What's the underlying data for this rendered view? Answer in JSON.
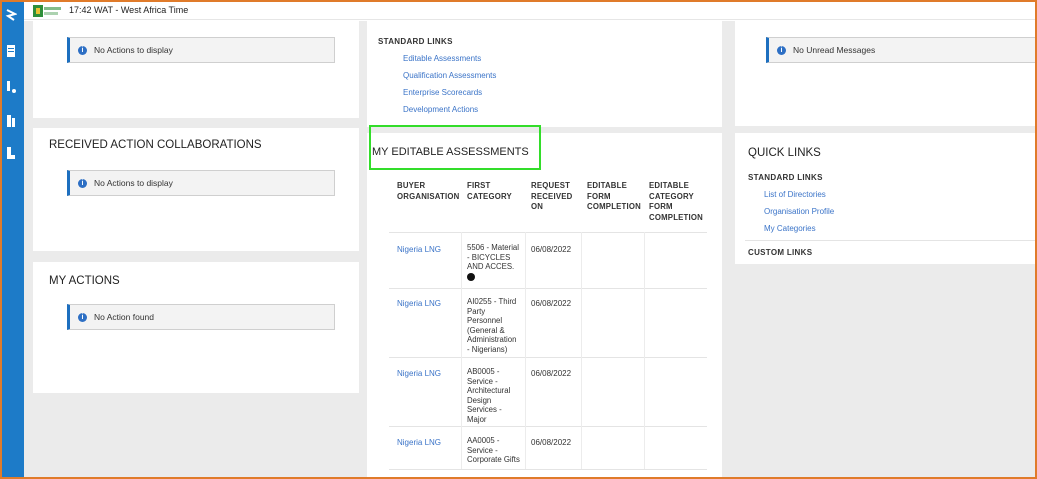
{
  "topbar": {
    "time_text": "17:42 WAT - West Africa Time"
  },
  "actions_card": {
    "message": "No Actions to display"
  },
  "received_collab": {
    "title": "RECEIVED ACTION COLLABORATIONS",
    "message": "No Actions to display"
  },
  "my_actions": {
    "title": "MY ACTIONS",
    "message": "No Action found"
  },
  "standard_links_top": {
    "heading": "STANDARD LINKS",
    "links": [
      "Editable Assessments",
      "Qualification Assessments",
      "Enterprise Scorecards",
      "Development Actions"
    ]
  },
  "editable_assessments": {
    "title": "MY EDITABLE ASSESSMENTS",
    "columns": [
      [
        "BUYER",
        "ORGANISATION"
      ],
      [
        "FIRST",
        "CATEGORY"
      ],
      [
        "REQUEST",
        "RECEIVED",
        "ON"
      ],
      [
        "EDITABLE",
        "FORM",
        "COMPLETION"
      ],
      [
        "EDITABLE",
        "CATEGORY",
        "FORM",
        "COMPLETION"
      ]
    ],
    "rows": [
      {
        "org": "Nigeria LNG",
        "category": [
          "5506 - Material",
          "- BICYCLES",
          "AND ACCES."
        ],
        "date": "06/08/2022"
      },
      {
        "org": "Nigeria LNG",
        "category": [
          "AI0255 - Third",
          "Party",
          "Personnel",
          "(General &",
          "Administration",
          "- Nigerians)"
        ],
        "date": "06/08/2022"
      },
      {
        "org": "Nigeria LNG",
        "category": [
          "AB0005 -",
          "Service -",
          "Architectural",
          "Design",
          "Services -",
          "Major"
        ],
        "date": "06/08/2022"
      },
      {
        "org": "Nigeria LNG",
        "category": [
          "AA0005 -",
          "Service -",
          "Corporate Gifts"
        ],
        "date": "06/08/2022"
      }
    ]
  },
  "messages_card": {
    "message": "No Unread Messages"
  },
  "quick_links": {
    "title": "QUICK LINKS",
    "standard_heading": "STANDARD LINKS",
    "links": [
      "List of Directories",
      "Organisation Profile",
      "My Categories"
    ],
    "custom_heading": "CUSTOM LINKS"
  },
  "colors": {
    "accent": "#1d7bc8",
    "link": "#3b74c8",
    "highlight": "#33dd2a",
    "frame": "#e07b2a"
  },
  "icons": [
    "menu-icon",
    "document-icon",
    "connections-icon",
    "reports-icon",
    "person-icon",
    "info-icon"
  ]
}
